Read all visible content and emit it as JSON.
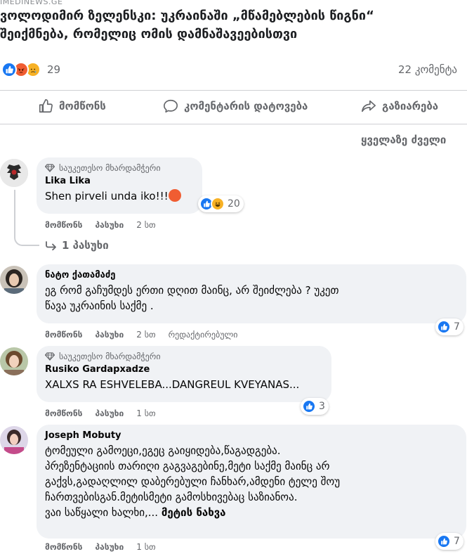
{
  "source_label": "IMEDINEWS.GE",
  "post": {
    "headline_line1": "ვოლოდიმირ ზელენსკი: უკრაინაში „მწამებლების წიგნი“",
    "headline_line2": "შეიქმნება, რომელიც ომის დამნაშავეებისთვი",
    "reaction_count": "29",
    "comment_count": "22 კომენტა",
    "reaction_icons": [
      "like-icon",
      "angry-icon",
      "sad-icon"
    ]
  },
  "actions": {
    "like": "მომწონს",
    "comment": "კომენტარის დატოვება",
    "share": "გაზიარება"
  },
  "sort_label": "ყველაზე ძველი",
  "labels": {
    "like": "მომწონს",
    "reply": "პასუხი",
    "edited": "რედაქტირებული",
    "top_fan": "საუკეთესო მხარდამჭერი"
  },
  "colors": {
    "like_blue": "#1877f2",
    "angry_orange": "#f05d32",
    "haha_yellow": "#f7b125",
    "bubble_bg": "#f0f2f5",
    "secondary_text": "#65676b"
  },
  "comments": [
    {
      "author": "Lika Lika",
      "text": "Shen pirveli unda iko!!!",
      "time": "2 სთ",
      "reaction_count": "20",
      "reply_count": "1 პასუხი",
      "reaction_icons": [
        "like-icon",
        "haha-icon"
      ]
    },
    {
      "author": "ნატო ქათამაძე",
      "text_line1": "ეგ რომ გაჩუმდეს ერთი დღით მაინც, არ შეიძლება ? უკეთ",
      "text_line2": "წავა უკრაინის საქმე .",
      "time": "2 სთ",
      "reaction_count": "7"
    },
    {
      "author": "Rusiko Gardapxadze",
      "text": "XALXS RA ESHVELEBA...DANGREUL KVEYANAS...",
      "time": "1 სთ",
      "reaction_count": "3"
    },
    {
      "author": "Joseph Mobuty",
      "text_line1": "ტომეული გამოეცი,ეგეც გაიყიდება,წაგადგება.",
      "text_line2": "პრეზენტაციის თარიღი გაგვაგებინე,მეტი საქმე მაინც არ",
      "text_line3": "გაქვს,გადაღლილ დაბერებული ჩანხარ,ამდენი ტელე შოუ",
      "text_line4": "ჩართვებისგან.მეტისმეტი გამოსხივებაც საზიანოა.",
      "text_line5": "ვაი საწყალი ხალხი,...",
      "see_more": "მეტის ნახვა",
      "time": "1 სთ",
      "reaction_count": "7"
    }
  ]
}
